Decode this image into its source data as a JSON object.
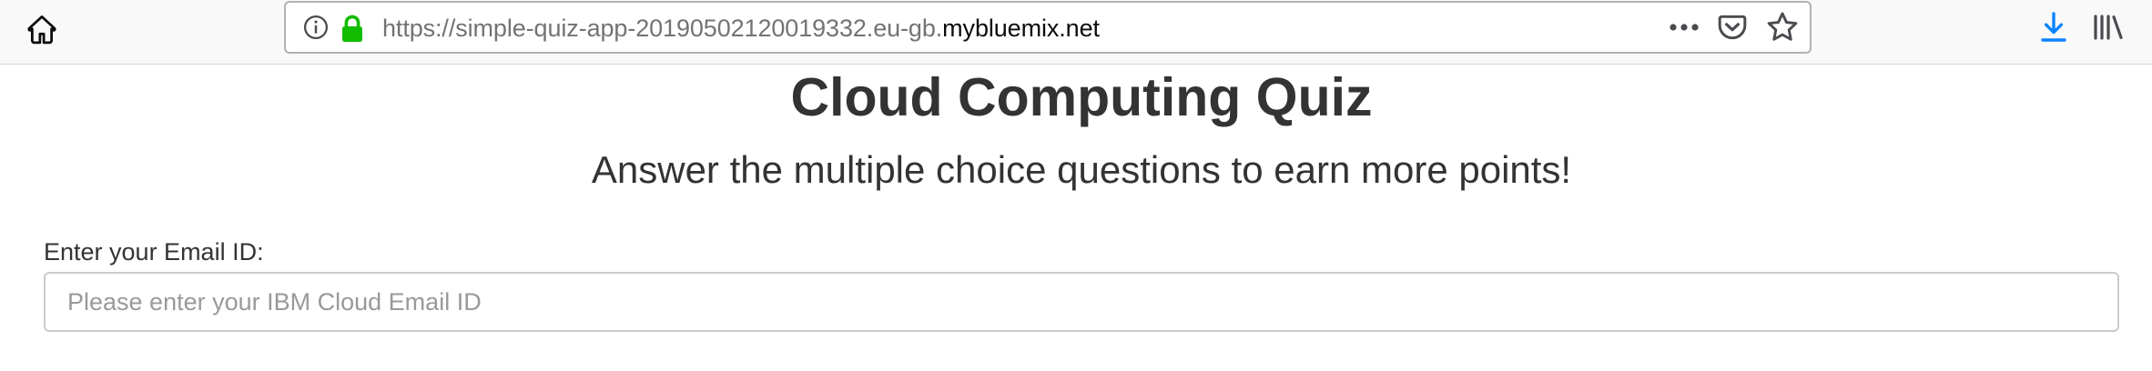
{
  "browser": {
    "url_prefix": "https://simple-quiz-app-20190502120019332.eu-gb.",
    "url_domain": "mybluemix.net",
    "icons": {
      "home": "home-icon",
      "info": "info-icon",
      "lock": "lock-icon",
      "more": "more-icon",
      "pocket": "pocket-icon",
      "bookmark": "star-icon",
      "downloads": "download-icon",
      "library": "library-icon"
    },
    "colors": {
      "lock": "#12bc00",
      "download": "#0a84ff"
    }
  },
  "page": {
    "title": "Cloud Computing Quiz",
    "subtitle": "Answer the multiple choice questions to earn more points!",
    "email_label": "Enter your Email ID:",
    "email_value": "",
    "email_placeholder": "Please enter your IBM Cloud Email ID"
  }
}
